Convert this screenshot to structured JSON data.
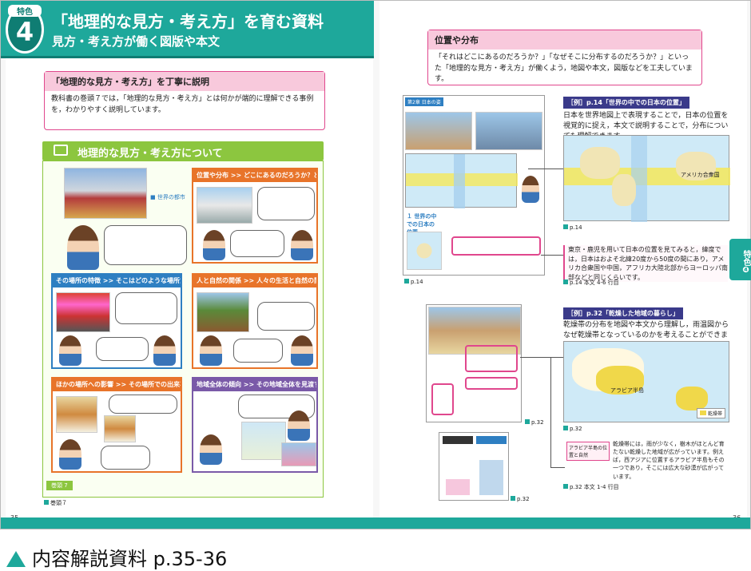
{
  "header": {
    "badge_label": "特色",
    "badge_number": "4",
    "title": "「地理的な見方・考え方」を育む資料",
    "subtitle": "見方・考え方が働く図版や本文"
  },
  "left_page": {
    "box_title": "「地理的な見方・考え方」を丁寧に説明",
    "box_text": "教科書の巻頭７では，「地理的な見方・考え方」とは何かが端的に理解できる事例を，わかりやすく説明しています。",
    "section_title": "地理的な見方・考え方について",
    "panels": [
      {
        "title": "位置や分布 >> どこにあるのだろうか？どこに広がっているのだろうか？",
        "color": "#e8742a"
      },
      {
        "title": "その場所の特徴 >> そこはどのような場所だろうか？",
        "color": "#2e7fc2"
      },
      {
        "title": "人と自然の関係 >> 人々の生活と自然の関係には，どのような関係があるのだろうか？",
        "color": "#e8742a"
      },
      {
        "title": "ほかの場所への影響 >> その場所での出来事は，ほかの場所にどのように影響しているだろうか？",
        "color": "#e8742a"
      },
      {
        "title": "地域全体の傾向 >> その地域全体を見渡すと，どのような特徴がみられるだろうか？",
        "color": "#7a5aa8"
      }
    ],
    "page_ref": "巻頭７",
    "page_number": "35",
    "footer_tag": "巻頭 7"
  },
  "right_page": {
    "box_title": "位置や分布",
    "box_text": "「それはどこにあるのだろうか？」「なぜそこに分布するのだろうか？」といった「地理的な見方・考え方」が働くよう，地図や本文，図版などを工夫しています。",
    "example1_label": "［例］p.14「世界の中での日本の位置」",
    "example1_desc": "日本を世界地図上で表現することで，日本の位置を視覚的に捉え，本文で説明することで，分布についても理解できます。",
    "example1_map_ref": "p.14",
    "example1_text_ref": "p.14 本文 4-6 行目",
    "example1_excerpt": "東京・鹿児を用いて日本の位置を見てみると，緯度では，日本はおよそ北緯20度から50度の間にあり，アメリカ合衆国や中国，アフリカ大陸北部からヨーロッパ南部などと同じくらいです。",
    "example2_label": "［例］p.32「乾燥した地域の暮らし」",
    "example2_desc": "乾燥帯の分布を地図や本文から理解し，雨温図からなぜ乾燥帯となっているのかを考えることができます。",
    "example2_map_ref": "p.32",
    "example2_text_ref": "p.32 本文 1-4 行目",
    "example2_excerpt_title": "アラビア半島の位置と自然",
    "example2_excerpt": "乾燥帯には，雨が少なく，樹木がほとんど育たない乾燥した地域が広がっています。例えば，西アジアに位置するアラビア半島もその一つであり，そこには広大な砂漠が広がっています。",
    "thumb_chapter": "第2章 日本の姿",
    "thumb_section": "１ 世界の中での日本の位置",
    "thumb_ref1": "p.14",
    "thumb_ref2": "p.32",
    "thumb_ref3": "p.32",
    "map_legend": "乾燥帯",
    "map_label_arabia": "アラビア半島",
    "map_label_africa": "アフリカ",
    "map_label_asia": "アジア",
    "map_label_usa": "アメリカ合衆国",
    "side_tab": "特色❹",
    "page_number": "36"
  },
  "caption": {
    "text": "内容解説資料 p.35-36"
  }
}
